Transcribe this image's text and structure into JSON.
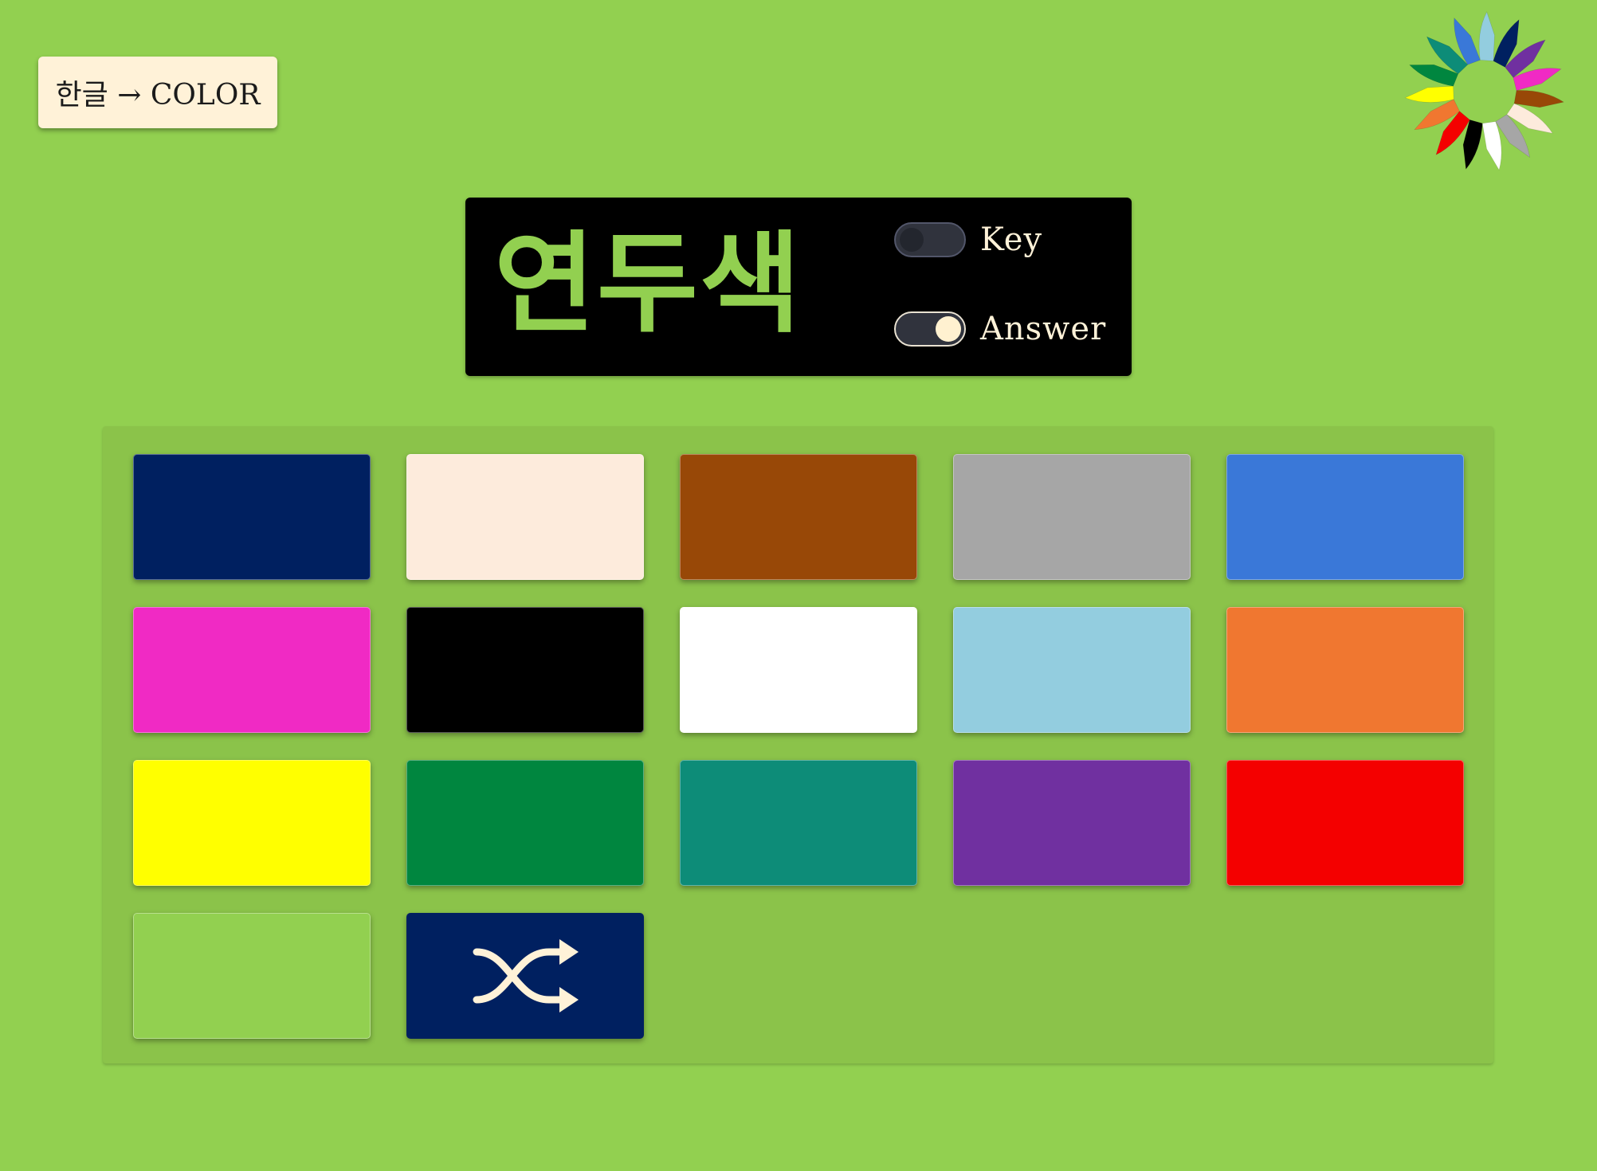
{
  "header": {
    "mode_label": "한글 → COLOR"
  },
  "logo": {
    "icon": "color-wheel-logo-icon",
    "petal_colors": [
      "#3a78d8",
      "#93cddf",
      "#002060",
      "#7030a0",
      "#f02ac4",
      "#984807",
      "#fdebdc",
      "#a6a6a6",
      "#ffffff",
      "#000000",
      "#f40000",
      "#f07730",
      "#ffff00",
      "#00863f",
      "#0d8c78"
    ]
  },
  "prompt": {
    "word": "연두색",
    "word_color": "#92d050",
    "key_toggle": {
      "label": "Key",
      "on": false
    },
    "answer_toggle": {
      "label": "Answer",
      "on": true
    }
  },
  "swatches": [
    {
      "color": "#002060"
    },
    {
      "color": "#fdebdc"
    },
    {
      "color": "#984807"
    },
    {
      "color": "#a6a6a6"
    },
    {
      "color": "#3a78d8"
    },
    {
      "color": "#f02ac4"
    },
    {
      "color": "#000000"
    },
    {
      "color": "#ffffff"
    },
    {
      "color": "#93cddf"
    },
    {
      "color": "#f07730"
    },
    {
      "color": "#ffff00"
    },
    {
      "color": "#00863f"
    },
    {
      "color": "#0d8c78"
    },
    {
      "color": "#7030a0"
    },
    {
      "color": "#f40000"
    },
    {
      "color": "#92d050"
    }
  ],
  "shuffle_button": {
    "icon": "shuffle-icon",
    "background": "#002060",
    "icon_color": "#fff2d8"
  }
}
